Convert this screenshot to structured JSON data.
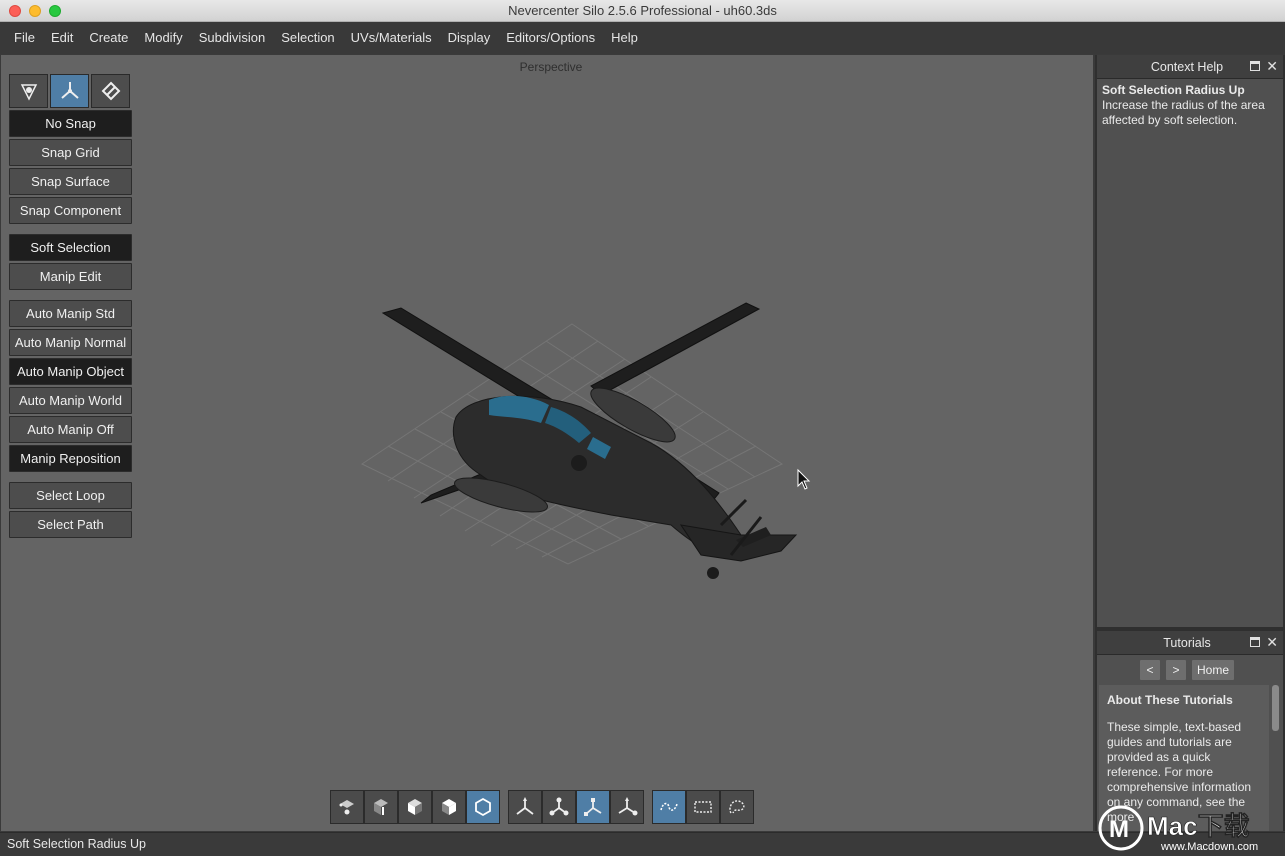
{
  "window": {
    "title": "Nevercenter Silo 2.5.6 Professional - uh60.3ds"
  },
  "menu": [
    "File",
    "Edit",
    "Create",
    "Modify",
    "Subdivision",
    "Selection",
    "UVs/Materials",
    "Display",
    "Editors/Options",
    "Help"
  ],
  "viewport": {
    "label": "Perspective"
  },
  "left_tools": {
    "modes": [
      "object-mode-icon",
      "manipulator-mode-icon",
      "component-mode-icon"
    ],
    "snap": [
      "No Snap",
      "Snap Grid",
      "Snap Surface",
      "Snap Component"
    ],
    "soft": [
      "Soft Selection",
      "Manip Edit"
    ],
    "manip": [
      "Auto Manip Std",
      "Auto Manip Normal",
      "Auto Manip Object",
      "Auto Manip World",
      "Auto Manip Off",
      "Manip Reposition"
    ],
    "select": [
      "Select Loop",
      "Select Path"
    ]
  },
  "bottom_tools": {
    "selection_modes": [
      "vertex-select-icon",
      "edge-select-icon",
      "face-select-icon",
      "face-normal-select-icon",
      "object-select-icon"
    ],
    "manipulators": [
      "move-manip-icon",
      "scale-manip-icon",
      "rotate-manip-icon",
      "universal-manip-icon"
    ],
    "selection_shapes": [
      "paint-select-icon",
      "rectangle-select-icon",
      "lasso-select-icon"
    ]
  },
  "context_help": {
    "title": "Context Help",
    "heading": "Soft Selection Radius Up",
    "body": "Increase the radius of the area affected by soft selection."
  },
  "tutorials": {
    "title": "Tutorials",
    "prev": "<",
    "next": ">",
    "home": "Home",
    "heading": "About These Tutorials",
    "body": "These simple, text-based guides and tutorials are provided as a quick reference. For more comprehensive information on any command, see the more"
  },
  "status": {
    "text": "Soft Selection Radius Up"
  },
  "watermark": {
    "text": "Mac下载",
    "url": "www.Macdown.com"
  }
}
